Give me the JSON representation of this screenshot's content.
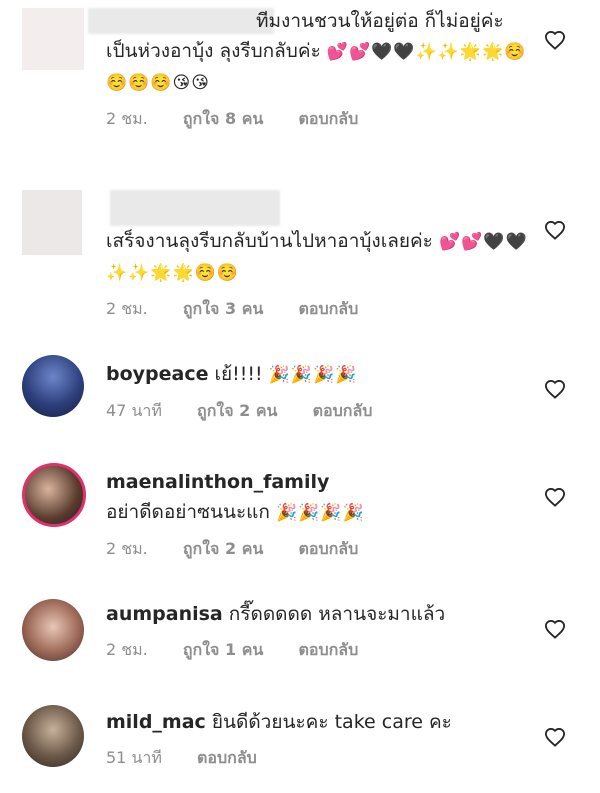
{
  "comments": [
    {
      "username": "",
      "text": "ทีมงานชวนให้อยู่ต่อ ก็ไม่อยู่ค่ะ เป็นห่วงอาบุ้ง ลุงรีบกลับค่ะ",
      "emoji": "💕💕🖤🖤✨✨🌟🌟☺️☺️☺️☺️😘😘",
      "time": "2 ชม.",
      "likes": "ถูกใจ 8 คน",
      "reply": "ตอบกลับ"
    },
    {
      "username": "",
      "text": "เสร็จงานลุงรีบกลับบ้านไปหาอาบุ้งเลยค่ะ",
      "emoji": "💕💕🖤🖤✨✨🌟🌟☺️☺️",
      "time": "2 ชม.",
      "likes": "ถูกใจ 3 คน",
      "reply": "ตอบกลับ"
    },
    {
      "username": "boypeace",
      "text": "เย้!!!!",
      "emoji": "🎉🎉🎉🎉",
      "time": "47 นาที",
      "likes": "ถูกใจ 2 คน",
      "reply": "ตอบกลับ"
    },
    {
      "username": "maenalinthon_family",
      "text": "อย่าดีดอย่าซนนะแก",
      "emoji": "🎉🎉🎉🎉",
      "time": "2 ชม.",
      "likes": "ถูกใจ 2 คน",
      "reply": "ตอบกลับ"
    },
    {
      "username": "aumpanisa",
      "text": "กรี๊ดดดดด หลานจะมาแล้ว",
      "emoji": "",
      "time": "2 ชม.",
      "likes": "ถูกใจ 1 คน",
      "reply": "ตอบกลับ"
    },
    {
      "username": "mild_mac",
      "text": "ยินดีด้วยนะคะ take care คะ",
      "emoji": "",
      "time": "51 นาที",
      "likes": "",
      "reply": "ตอบกลับ"
    }
  ],
  "icons": {
    "like": "heart-outline-icon"
  },
  "colors": {
    "text": "#262626",
    "meta": "#8e8e8e",
    "heart": "#262626"
  }
}
